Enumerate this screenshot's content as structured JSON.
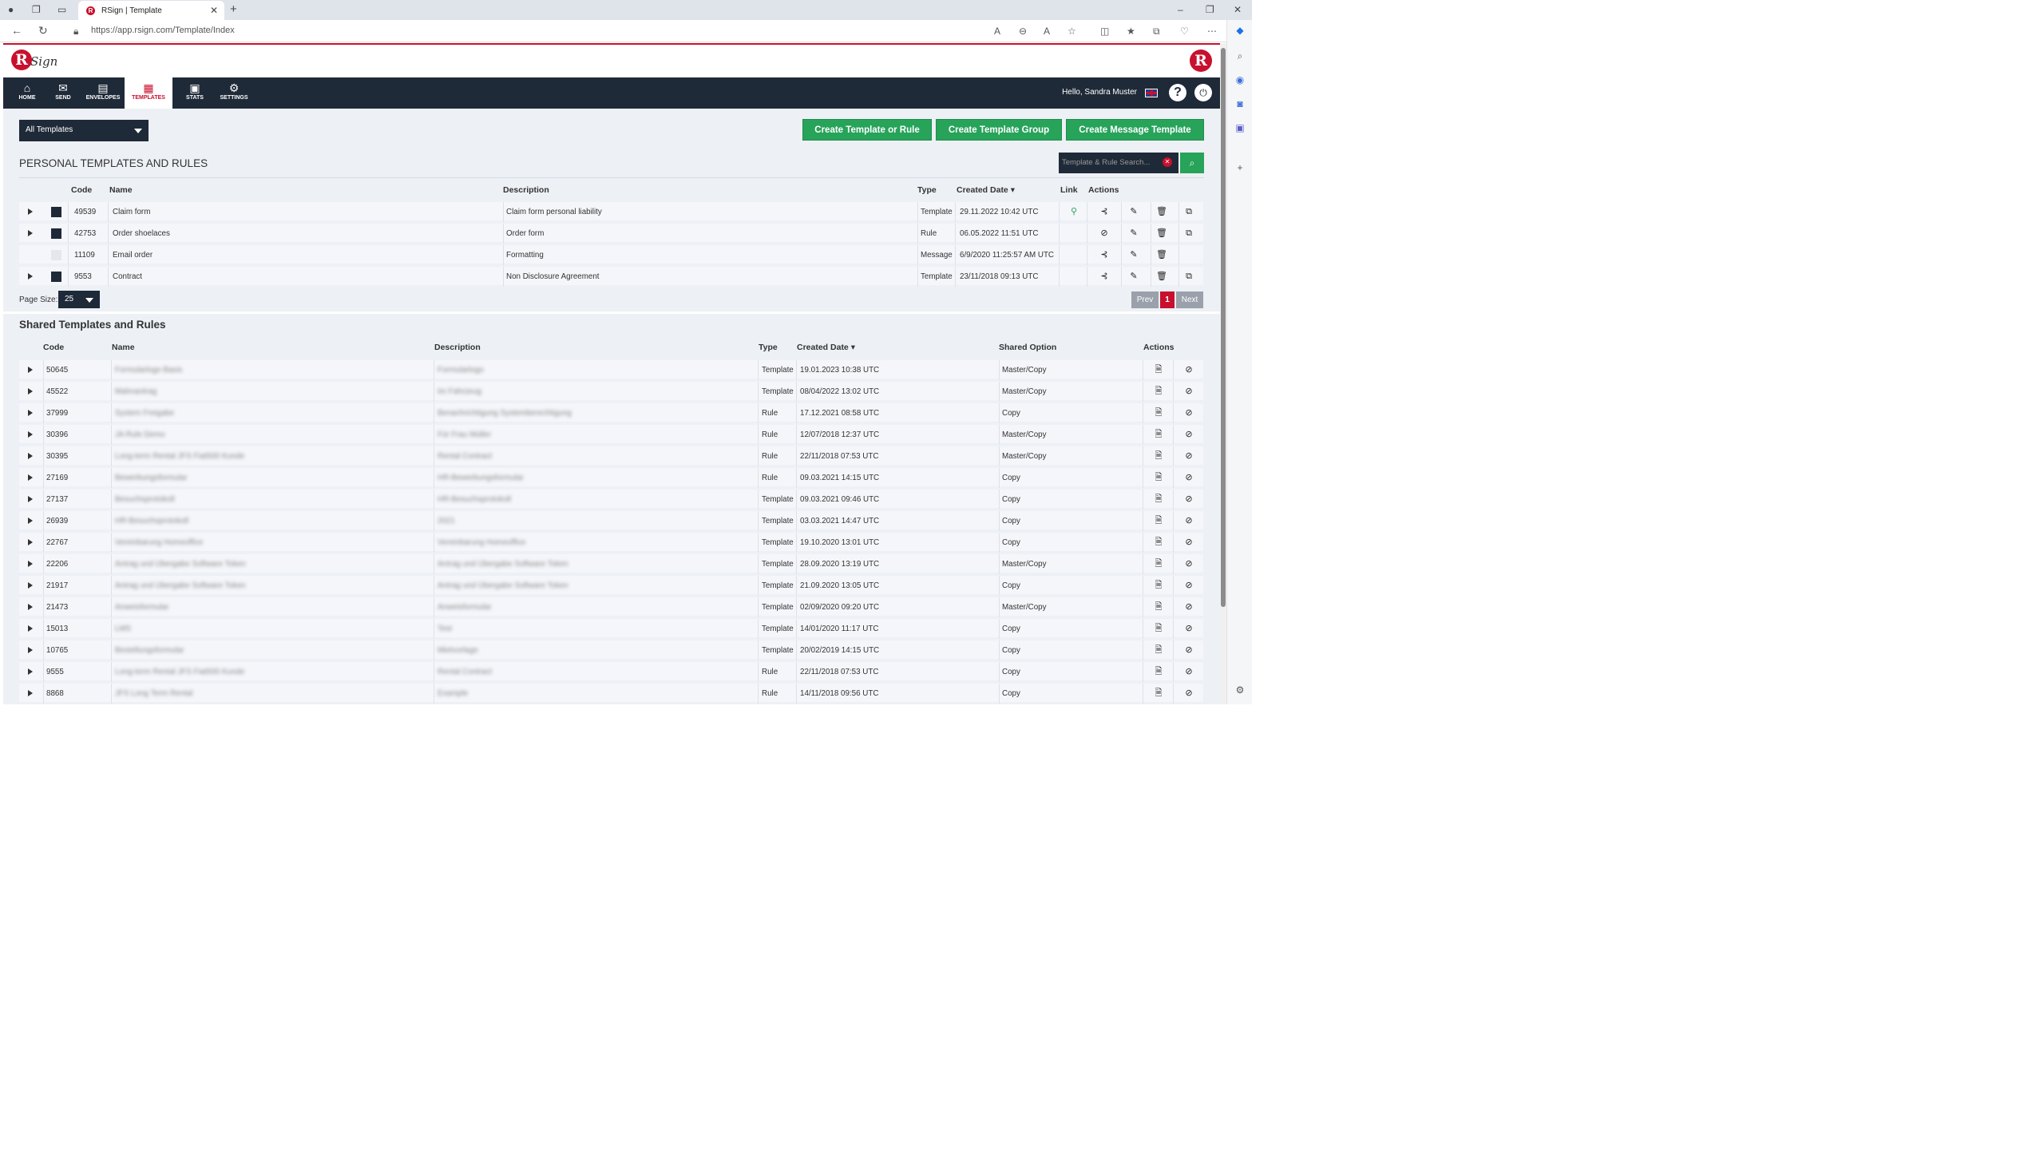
{
  "browser": {
    "tab_title": "RSign | Template",
    "url": "https://app.rsign.com/Template/Index"
  },
  "header": {
    "logo_text": "Sign",
    "greeting": "Hello, Sandra Muster"
  },
  "nav": [
    {
      "label": "HOME",
      "icon": "home-icon",
      "glyph": "⌂"
    },
    {
      "label": "SEND",
      "icon": "envelope-icon",
      "glyph": "✉"
    },
    {
      "label": "ENVELOPES",
      "icon": "inbox-icon",
      "glyph": "▤"
    },
    {
      "label": "TEMPLATES",
      "icon": "templates-icon",
      "glyph": "▦",
      "active": true
    },
    {
      "label": "STATS",
      "icon": "briefcase-icon",
      "glyph": "▣"
    },
    {
      "label": "SETTINGS",
      "icon": "gear-icon",
      "glyph": "⚙"
    }
  ],
  "toolbar": {
    "filter_value": "All Templates",
    "create_template_or_rule": "Create Template or Rule",
    "create_template_group": "Create Template Group",
    "create_message_template": "Create Message Template"
  },
  "personal": {
    "title": "PERSONAL TEMPLATES AND RULES",
    "search_placeholder": "Template & Rule Search...",
    "columns": {
      "code": "Code",
      "name": "Name",
      "description": "Description",
      "type": "Type",
      "created": "Created Date",
      "link": "Link",
      "actions": "Actions"
    },
    "rows": [
      {
        "code": "49539",
        "name": "Claim form",
        "description": "Claim form personal liability",
        "type": "Template",
        "created": "29.11.2022 10:42 UTC",
        "expandable": true,
        "checked": true,
        "link": true,
        "copy": true,
        "action1": "share"
      },
      {
        "code": "42753",
        "name": "Order shoelaces",
        "description": "Order form",
        "type": "Rule",
        "created": "06.05.2022 11:51 UTC",
        "expandable": true,
        "checked": true,
        "link": false,
        "copy": true,
        "action1": "unshare"
      },
      {
        "code": "11109",
        "name": "Email order",
        "description": "Formatting",
        "type": "Message",
        "created": "6/9/2020 11:25:57 AM UTC",
        "expandable": false,
        "checked": false,
        "link": false,
        "copy": false,
        "action1": "share"
      },
      {
        "code": "9553",
        "name": "Contract",
        "description": "Non Disclosure Agreement",
        "type": "Template",
        "created": "23/11/2018 09:13 UTC",
        "expandable": true,
        "checked": true,
        "link": false,
        "copy": true,
        "action1": "share"
      }
    ],
    "page_size_label": "Page Size:",
    "page_size": "25",
    "pagination": {
      "prev": "Prev",
      "current": "1",
      "next": "Next"
    }
  },
  "shared": {
    "title": "Shared Templates and Rules",
    "columns": {
      "code": "Code",
      "name": "Name",
      "description": "Description",
      "type": "Type",
      "created": "Created Date",
      "shared_option": "Shared Option",
      "actions": "Actions"
    },
    "rows": [
      {
        "code": "50645",
        "name": "Formularlogo Basis",
        "description": "Formularlogo",
        "type": "Template",
        "created": "19.01.2023 10:38 UTC",
        "option": "Master/Copy"
      },
      {
        "code": "45522",
        "name": "Mahnantrag",
        "description": "Im Fahrzeug",
        "type": "Template",
        "created": "08/04/2022 13:02 UTC",
        "option": "Master/Copy"
      },
      {
        "code": "37999",
        "name": "System Freigabe",
        "description": "Benachrichtigung Systemberechtigung",
        "type": "Rule",
        "created": "17.12.2021 08:58 UTC",
        "option": "Copy"
      },
      {
        "code": "30396",
        "name": "JA Rule Demo",
        "description": "Für Frau Müller",
        "type": "Rule",
        "created": "12/07/2018 12:37 UTC",
        "option": "Master/Copy"
      },
      {
        "code": "30395",
        "name": "Long-term Rental JFS Fiat500 Kunde",
        "description": "Rental Contract",
        "type": "Rule",
        "created": "22/11/2018 07:53 UTC",
        "option": "Master/Copy"
      },
      {
        "code": "27169",
        "name": "Bewerbungsformular",
        "description": "HR-Bewerbungsformular",
        "type": "Rule",
        "created": "09.03.2021 14:15 UTC",
        "option": "Copy"
      },
      {
        "code": "27137",
        "name": "Besuchsprotokoll",
        "description": "HR-Besuchsprotokoll",
        "type": "Template",
        "created": "09.03.2021 09:46 UTC",
        "option": "Copy"
      },
      {
        "code": "26939",
        "name": "HR-Besuchsprotokoll",
        "description": "2021",
        "type": "Template",
        "created": "03.03.2021 14:47 UTC",
        "option": "Copy"
      },
      {
        "code": "22767",
        "name": "Vereinbarung Homeoffice",
        "description": "Vereinbarung Homeoffice",
        "type": "Template",
        "created": "19.10.2020 13:01 UTC",
        "option": "Copy"
      },
      {
        "code": "22206",
        "name": "Antrag und Übergabe Software Token",
        "description": "Antrag und Übergabe Software Token",
        "type": "Template",
        "created": "28.09.2020 13:19 UTC",
        "option": "Master/Copy"
      },
      {
        "code": "21917",
        "name": "Antrag und Übergabe Software Token",
        "description": "Antrag und Übergabe Software Token",
        "type": "Template",
        "created": "21.09.2020 13:05 UTC",
        "option": "Copy"
      },
      {
        "code": "21473",
        "name": "Anweisformular",
        "description": "Anweisformular",
        "type": "Template",
        "created": "02/09/2020 09:20 UTC",
        "option": "Master/Copy"
      },
      {
        "code": "15013",
        "name": "LMS",
        "description": "Test",
        "type": "Template",
        "created": "14/01/2020 11:17 UTC",
        "option": "Copy"
      },
      {
        "code": "10765",
        "name": "Bestellungsformular",
        "description": "Mietvorlage",
        "type": "Template",
        "created": "20/02/2019 14:15 UTC",
        "option": "Copy"
      },
      {
        "code": "9555",
        "name": "Long-term Rental JFS Fiat500 Kunde",
        "description": "Rental Contract",
        "type": "Rule",
        "created": "22/11/2018 07:53 UTC",
        "option": "Copy"
      },
      {
        "code": "8868",
        "name": "JFS Long Term Rental",
        "description": "Example",
        "type": "Rule",
        "created": "14/11/2018 09:56 UTC",
        "option": "Copy"
      }
    ]
  }
}
